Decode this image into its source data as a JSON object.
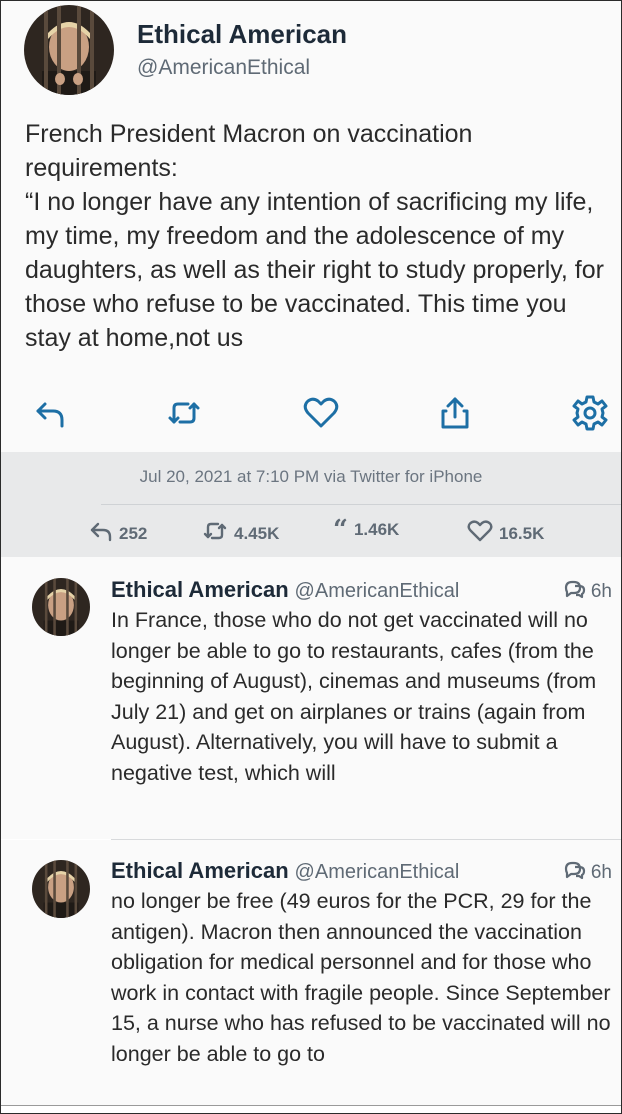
{
  "tweet": {
    "author_name": "Ethical American",
    "author_handle": "@AmericanEthical",
    "text": "French President Macron on vaccination requirements:\n“I no longer have any intention of sacrificing my life, my time, my freedom and the adolescence of my daughters, as well as their right to study properly, for those who refuse to be vaccinated. This time you stay at home,not us",
    "timestamp": "Jul 20, 2021 at 7:10 PM via Twitter for iPhone",
    "actions": [
      "reply-icon",
      "retweet-icon",
      "like-icon",
      "share-icon",
      "settings-icon"
    ]
  },
  "stats": {
    "replies": "252",
    "retweets": "4.45K",
    "quotes": "1.46K",
    "likes": "16.5K"
  },
  "replies": [
    {
      "name": "Ethical American",
      "handle": "@AmericanEthical",
      "time": "6h",
      "text": "In France, those who do not get vaccinated will no longer be able to go to restaurants, cafes (from the beginning of August), cinemas and museums (from July 21) and get on airplanes or trains (again from August). Alternatively, you will have to submit a negative test, which will"
    },
    {
      "name": "Ethical American",
      "handle": "@AmericanEthical",
      "time": "6h",
      "text": "no longer be free (49 euros for the PCR, 29 for the antigen). Macron then announced the vaccination obligation for medical personnel and for those who work in contact with fragile people. Since September 15, a nurse who has refused to be vaccinated will no longer be able to go to"
    }
  ],
  "colors": {
    "accent": "#1d6fa5",
    "meta_bg": "#e8e9ea",
    "muted": "#5f6a75"
  }
}
